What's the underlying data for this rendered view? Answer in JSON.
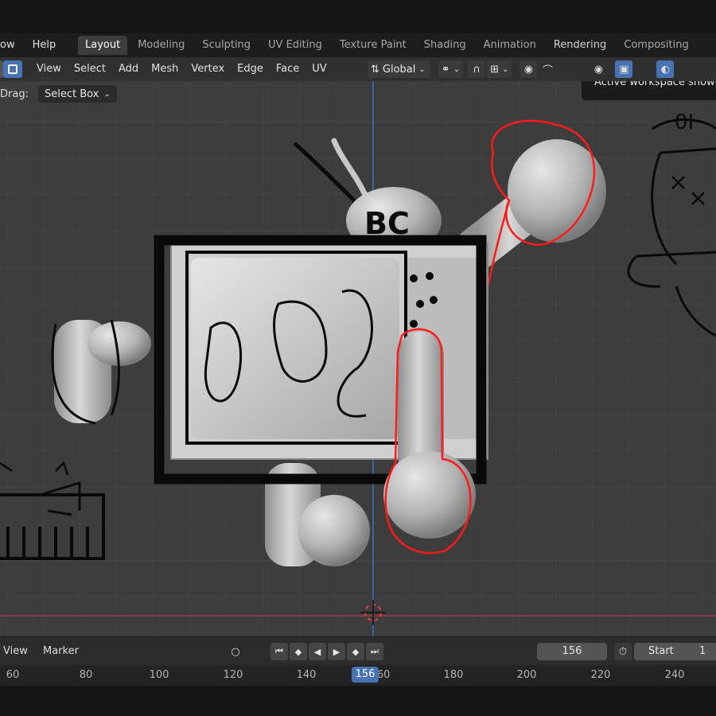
{
  "menubar": {
    "items": [
      "ow",
      "Help"
    ],
    "workspaces": [
      "Layout",
      "Modeling",
      "Sculpting",
      "UV Editing",
      "Texture Paint",
      "Shading",
      "Animation",
      "Rendering",
      "Compositing"
    ],
    "active_workspace": "Layout"
  },
  "header": {
    "menus": [
      "View",
      "Select",
      "Add",
      "Mesh",
      "Vertex",
      "Edge",
      "Face",
      "UV"
    ],
    "transform_orientation": "Global"
  },
  "viewport": {
    "drag_label": "Drag:",
    "drag_value": "Select Box",
    "tooltip": "Active workspace showing"
  },
  "timeline": {
    "menus": [
      "View",
      "Marker"
    ],
    "current_frame": "156",
    "start_label": "Start",
    "start_value": "1",
    "ruler_ticks": [
      "60",
      "80",
      "100",
      "120",
      "140",
      "160",
      "180",
      "200",
      "220",
      "240"
    ]
  },
  "colors": {
    "accent": "#4772b3",
    "annotation_red": "#ff1a1a",
    "annotation_black": "#0a0a0a",
    "grid": "#484848",
    "x_axis": "#b03040",
    "y_axis": "#3d6fc0"
  }
}
